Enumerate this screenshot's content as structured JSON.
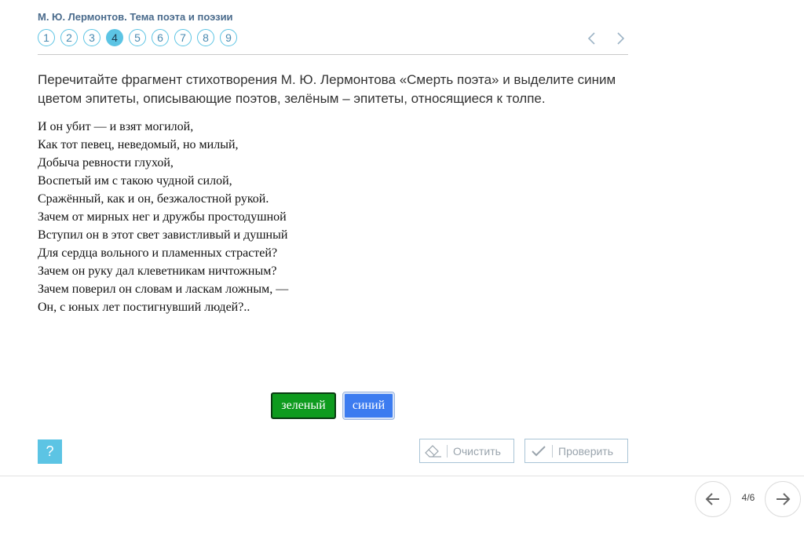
{
  "header": {
    "breadcrumb": "М. Ю. Лермонтов. Тема поэта и поэзии",
    "steps": [
      "1",
      "2",
      "3",
      "4",
      "5",
      "6",
      "7",
      "8",
      "9"
    ],
    "active_step": "4"
  },
  "task": {
    "instruction": "Перечитайте фрагмент стихотворения М. Ю. Лермонтова «Смерть поэта» и выделите синим цветом эпитеты, описывающие поэтов, зелёным – эпитеты, относящиеся к толпе."
  },
  "poem": {
    "lines": [
      "И он убит — и взят могилой,",
      "Как тот певец, неведомый, но милый,",
      "Добыча ревности глухой,",
      "Воспетый им с такою чудной силой,",
      "Сражённый, как и он, безжалостной рукой.",
      "Зачем от мирных нег и дружбы простодушной",
      "Вступил он в этот свет завистливый и душный",
      "Для сердца вольного и пламенных страстей?",
      "Зачем он руку дал клеветникам ничтожным?",
      "Зачем поверил он словам и ласкам ложным, —",
      "Он, с юных лет постигнувший людей?.."
    ]
  },
  "color_buttons": {
    "green_label": "зеленый",
    "blue_label": "синий"
  },
  "actions": {
    "help_label": "?",
    "clear_label": "Очистить",
    "check_label": "Проверить"
  },
  "pager": {
    "count": "4/6"
  },
  "colors": {
    "accent": "#5cc4e4",
    "green": "#0e9b1e",
    "blue": "#3c7cf0"
  }
}
